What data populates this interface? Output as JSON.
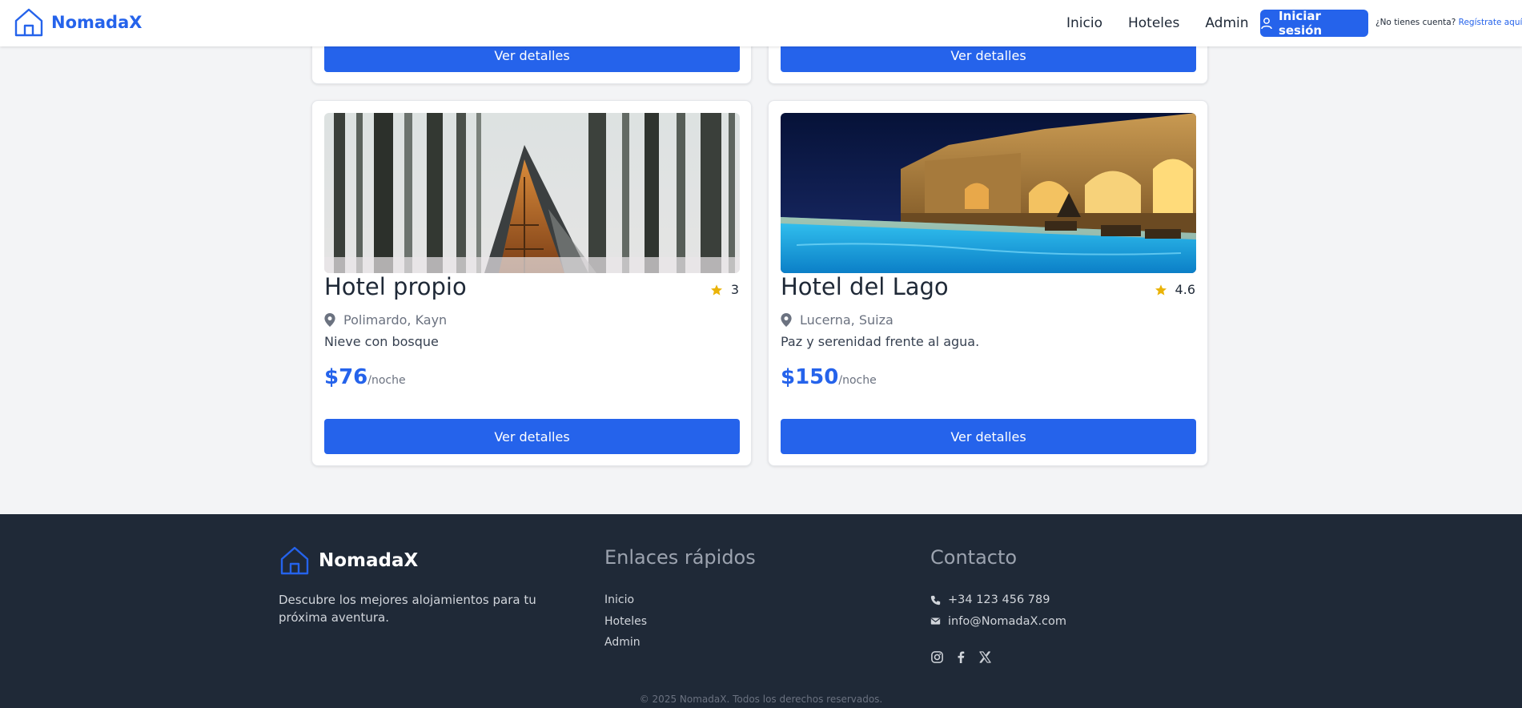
{
  "header": {
    "brand": "NomadaX",
    "nav": [
      "Inicio",
      "Hoteles",
      "Admin"
    ],
    "login_label": "Iniciar sesión",
    "signup_prompt": "¿No tienes cuenta?",
    "signup_link": "Regístrate aquí"
  },
  "top_cards": [
    {
      "button": "Ver detalles"
    },
    {
      "button": "Ver detalles"
    }
  ],
  "hotels": [
    {
      "name": "Hotel propio",
      "rating": "3",
      "location": "Polimardo, Kayn",
      "description": "Nieve con bosque",
      "price": "$76",
      "per_night": "/noche",
      "button": "Ver detalles",
      "image": "a-frame cabin in snowy forest"
    },
    {
      "name": "Hotel del Lago",
      "rating": "4.6",
      "location": "Lucerna, Suiza",
      "description": "Paz y serenidad frente al agua.",
      "price": "$150",
      "per_night": "/noche",
      "button": "Ver detalles",
      "image": "stone hotel with illuminated pool at night"
    }
  ],
  "footer": {
    "brand": "NomadaX",
    "description": "Descubre los mejores alojamientos para tu próxima aventura.",
    "links_heading": "Enlaces rápidos",
    "links": [
      "Inicio",
      "Hoteles",
      "Admin"
    ],
    "contact_heading": "Contacto",
    "phone": "+34 123 456 789",
    "email": "info@NomadaX.com",
    "socials": [
      "instagram-icon",
      "facebook-icon",
      "x-icon"
    ],
    "copyright": "© 2025 NomadaX. Todos los derechos reservados."
  },
  "colors": {
    "primary": "#2563eb",
    "star": "#eab308",
    "footer_bg": "#1f2937",
    "page_bg": "#f3f4f6"
  }
}
